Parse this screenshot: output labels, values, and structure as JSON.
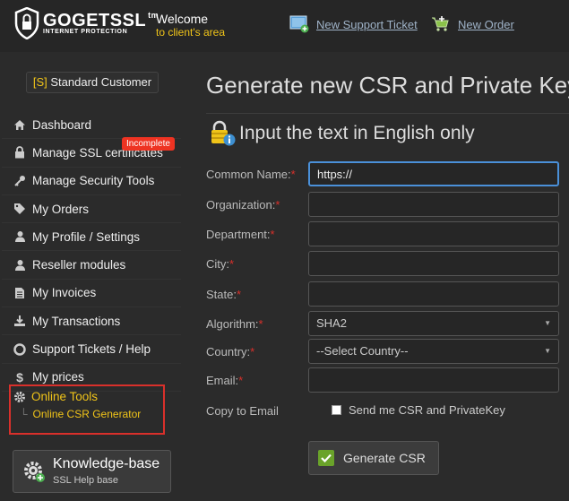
{
  "header": {
    "logo_text": "GOGETSSL",
    "logo_tm": "tm",
    "logo_sub": "INTERNET PROTECTION",
    "welcome": "Welcome",
    "welcome_sub": "to client's area",
    "new_ticket": "New Support Ticket",
    "new_order": "New Order"
  },
  "sidebar": {
    "customer_prefix": "[S]",
    "customer_type": "Standard Customer",
    "items": [
      {
        "label": "Dashboard",
        "icon": "home-icon"
      },
      {
        "label": "Manage SSL certificates",
        "icon": "lock-icon",
        "badge": "Incomplete"
      },
      {
        "label": "Manage Security Tools",
        "icon": "key-icon"
      },
      {
        "label": "My Orders",
        "icon": "tag-icon"
      },
      {
        "label": "My Profile / Settings",
        "icon": "user-icon"
      },
      {
        "label": "Reseller modules",
        "icon": "user-icon"
      },
      {
        "label": "My Invoices",
        "icon": "document-icon"
      },
      {
        "label": "My Transactions",
        "icon": "download-icon"
      },
      {
        "label": "Support Tickets / Help",
        "icon": "lifebuoy-icon"
      },
      {
        "label": "My prices",
        "icon": "dollar-icon"
      }
    ],
    "tools": {
      "label": "Online Tools",
      "sub": "Online CSR Generator"
    },
    "kb": {
      "title": "Knowledge-base",
      "sub": "SSL Help base"
    }
  },
  "main": {
    "title": "Generate new CSR and Private Key",
    "subtitle": "Input the text in English only",
    "fields": {
      "common_name": {
        "label": "Common Name:",
        "value": "https://"
      },
      "organization": {
        "label": "Organization:",
        "value": ""
      },
      "department": {
        "label": "Department:",
        "value": ""
      },
      "city": {
        "label": "City:",
        "value": ""
      },
      "state": {
        "label": "State:",
        "value": ""
      },
      "algorithm": {
        "label": "Algorithm:",
        "value": "SHA2"
      },
      "country": {
        "label": "Country:",
        "value": "--Select Country--"
      },
      "email": {
        "label": "Email:",
        "value": ""
      }
    },
    "copy_to_email": {
      "label": "Copy to Email",
      "checkbox_label": "Send me CSR and PrivateKey"
    },
    "required_mark": "*",
    "generate_button": "Generate CSR"
  },
  "colors": {
    "accent_yellow": "#f0c419",
    "highlight_red": "#d9302b",
    "focus_blue": "#4a90d9",
    "button_green": "#6aa32a"
  }
}
